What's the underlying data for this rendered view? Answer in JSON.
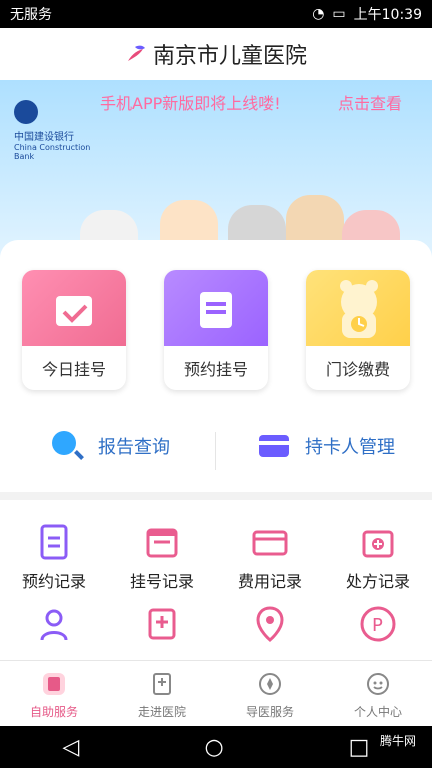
{
  "status": {
    "carrier": "无服务",
    "time": "上午10:39"
  },
  "header": {
    "title": "南京市儿童医院"
  },
  "banner": {
    "bank_name": "中国建设银行",
    "bank_name_en": "China Construction Bank",
    "announcement": "手机APP新版即将上线喽!",
    "view_more": "点击查看"
  },
  "quick_actions": [
    {
      "label": "今日挂号",
      "color": "#f06c92",
      "icon": "calendar-check-icon"
    },
    {
      "label": "预约挂号",
      "color": "#9b63ff",
      "icon": "document-icon"
    },
    {
      "label": "门诊缴费",
      "color": "#ffd04a",
      "icon": "bear-clock-icon"
    }
  ],
  "services": [
    {
      "label": "报告查询",
      "icon": "search-icon"
    },
    {
      "label": "持卡人管理",
      "icon": "card-icon"
    }
  ],
  "grid": [
    {
      "label": "预约记录",
      "icon": "document-icon"
    },
    {
      "label": "挂号记录",
      "icon": "calendar-icon"
    },
    {
      "label": "费用记录",
      "icon": "card-icon"
    },
    {
      "label": "处方记录",
      "icon": "medicine-box-icon"
    },
    {
      "label": "",
      "icon": "person-icon"
    },
    {
      "label": "",
      "icon": "hospital-icon"
    },
    {
      "label": "",
      "icon": "location-icon"
    },
    {
      "label": "",
      "icon": "parking-icon"
    }
  ],
  "tabbar": [
    {
      "label": "自助服务",
      "active": true,
      "icon": "self-service-icon"
    },
    {
      "label": "走进医院",
      "active": false,
      "icon": "hospital-info-icon"
    },
    {
      "label": "导医服务",
      "active": false,
      "icon": "compass-icon"
    },
    {
      "label": "个人中心",
      "active": false,
      "icon": "user-face-icon"
    }
  ],
  "watermark": "腾牛网"
}
